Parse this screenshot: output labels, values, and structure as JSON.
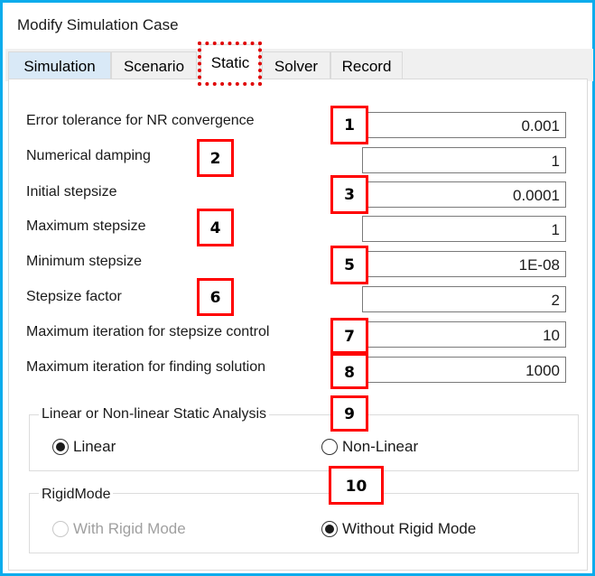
{
  "window": {
    "title": "Modify Simulation Case"
  },
  "tabs": [
    {
      "label": "Simulation",
      "active": false
    },
    {
      "label": "Scenario",
      "active": false
    },
    {
      "label": "Static",
      "active": true
    },
    {
      "label": "Solver",
      "active": false
    },
    {
      "label": "Record",
      "active": false
    }
  ],
  "fields": [
    {
      "label": "Error tolerance for NR convergence",
      "value": "0.001",
      "badge": "1"
    },
    {
      "label": "Numerical damping",
      "value": "1",
      "badge": "2"
    },
    {
      "label": "Initial stepsize",
      "value": "0.0001",
      "badge": "3"
    },
    {
      "label": "Maximum stepsize",
      "value": "1",
      "badge": "4"
    },
    {
      "label": "Minimum stepsize",
      "value": "1E-08",
      "badge": "5"
    },
    {
      "label": "Stepsize factor",
      "value": "2",
      "badge": "6"
    },
    {
      "label": "Maximum iteration for stepsize control",
      "value": "10",
      "badge": "7"
    },
    {
      "label": "Maximum iteration for finding solution",
      "value": "1000",
      "badge": "8"
    }
  ],
  "analysis_group": {
    "label": "Linear or Non-linear Static Analysis",
    "badge": "9",
    "options": [
      {
        "label": "Linear",
        "selected": true,
        "enabled": true
      },
      {
        "label": "Non-Linear",
        "selected": false,
        "enabled": true
      }
    ]
  },
  "rigid_group": {
    "label": "RigidMode",
    "badge": "10",
    "options": [
      {
        "label": "With Rigid Mode",
        "selected": false,
        "enabled": false
      },
      {
        "label": "Without Rigid Mode",
        "selected": true,
        "enabled": true
      }
    ]
  },
  "colors": {
    "window_border": "#0aacec",
    "annotation": "#ff0000"
  }
}
